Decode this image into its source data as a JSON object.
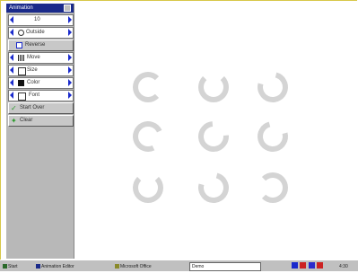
{
  "panel": {
    "title": "Animation",
    "controls": [
      {
        "label": "10"
      },
      {
        "label": "Outside"
      },
      {
        "label": "Reverse"
      },
      {
        "label": "Move"
      },
      {
        "label": "Size"
      },
      {
        "label": "Color"
      },
      {
        "label": "Font"
      }
    ],
    "buttons": [
      {
        "label": "Start Over",
        "icon": "checkmark-icon"
      },
      {
        "label": "Clear",
        "icon": "sparkle-icon"
      }
    ]
  },
  "rings": {
    "count": 9,
    "color": "#d4d4d4"
  },
  "taskbar": {
    "items": [
      {
        "label": "Start"
      },
      {
        "label": "Animation Editor"
      },
      {
        "label": "Microsoft Office"
      }
    ],
    "input_value": "Demo",
    "clock": "4:30"
  },
  "colors": {
    "title_bar": "#1a2a8a",
    "arrow": "#1a2acc",
    "panel": "#b8b8b8"
  }
}
